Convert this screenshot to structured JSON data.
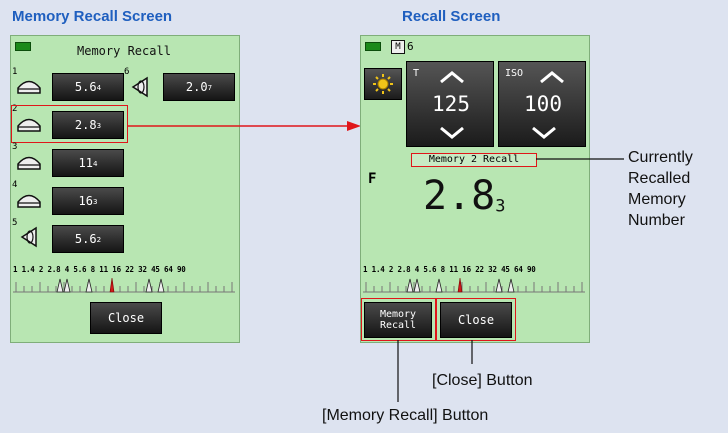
{
  "left": {
    "heading": "Memory Recall Screen",
    "title": "Memory Recall",
    "memories": [
      {
        "index": "1",
        "main": "5.6",
        "sub": "4",
        "icon": "dome-icon"
      },
      {
        "index": "2",
        "main": "2.8",
        "sub": "3",
        "icon": "dome-icon"
      },
      {
        "index": "3",
        "main": "11",
        "sub": "4",
        "icon": "dome-icon"
      },
      {
        "index": "4",
        "main": "16",
        "sub": "3",
        "icon": "dome-icon"
      },
      {
        "index": "5",
        "main": "5.6",
        "sub": "2",
        "icon": "flat-disc-icon"
      },
      {
        "index": "6",
        "main": "2.0",
        "sub": "7",
        "icon": "flat-disc-icon"
      }
    ],
    "scale": "1 1.4 2 2.8 4 5.6 8 11 16 22 32 45 64 90",
    "close": "Close"
  },
  "right": {
    "heading": "Recall Screen",
    "memory_badge": "M",
    "memory_count": "6",
    "t_label": "T",
    "t_value": "125",
    "iso_label": "ISO",
    "iso_value": "100",
    "recall_label": "Memory 2 Recall",
    "f_label": "F",
    "f_main": "2.8",
    "f_sub": "3",
    "scale": "1 1.4 2 2.8 4 5.6 8 11 16 22 32 45 64 90",
    "memory_recall_line1": "Memory",
    "memory_recall_line2": "Recall",
    "close": "Close"
  },
  "callouts": {
    "recalled_line1": "Currently",
    "recalled_line2": "Recalled",
    "recalled_line3": "Memory",
    "recalled_line4": "Number",
    "close_button": "[Close] Button",
    "memory_recall_button": "[Memory Recall] Button"
  },
  "colors": {
    "highlight": "#e0161a",
    "screen": "#b8e6b2",
    "heading": "#1f5fbf"
  }
}
